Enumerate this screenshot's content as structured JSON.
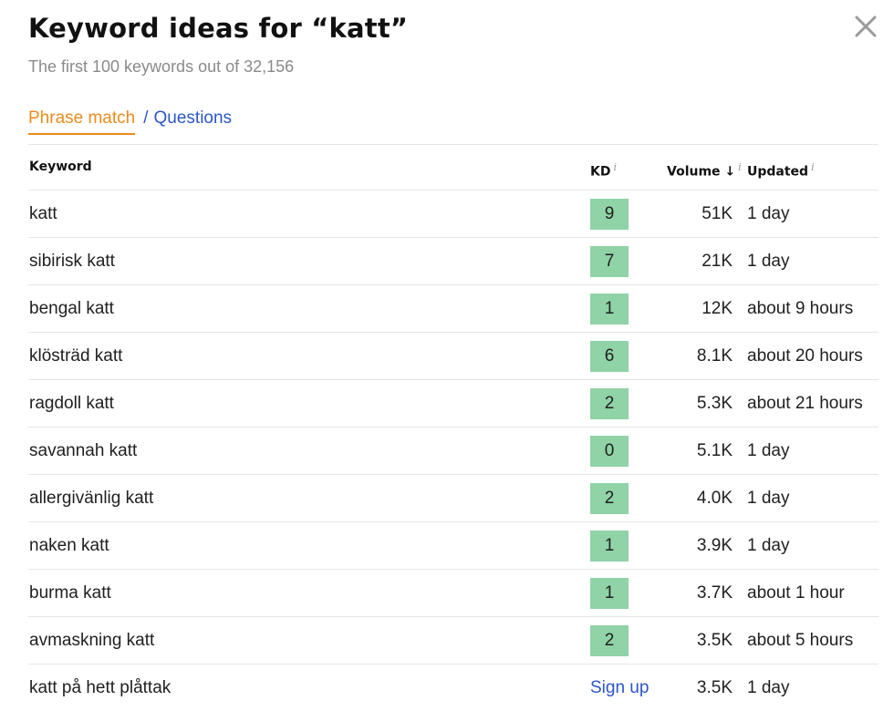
{
  "header": {
    "title": "Keyword ideas for “katt”",
    "subtitle": "The first 100 keywords out of 32,156"
  },
  "tabs": {
    "active": "Phrase match",
    "separator": "/",
    "other": "Questions"
  },
  "columns": {
    "keyword": "Keyword",
    "kd": "KD",
    "volume": "Volume",
    "volume_sort": "↓",
    "updated": "Updated",
    "info": "i"
  },
  "rows": [
    {
      "keyword": "katt",
      "kd": "9",
      "volume": "51K",
      "updated": "1 day"
    },
    {
      "keyword": "sibirisk katt",
      "kd": "7",
      "volume": "21K",
      "updated": "1 day"
    },
    {
      "keyword": "bengal katt",
      "kd": "1",
      "volume": "12K",
      "updated": "about 9 hours"
    },
    {
      "keyword": "klösträd katt",
      "kd": "6",
      "volume": "8.1K",
      "updated": "about 20 hours"
    },
    {
      "keyword": "ragdoll katt",
      "kd": "2",
      "volume": "5.3K",
      "updated": "about 21 hours"
    },
    {
      "keyword": "savannah katt",
      "kd": "0",
      "volume": "5.1K",
      "updated": "1 day"
    },
    {
      "keyword": "allergivänlig katt",
      "kd": "2",
      "volume": "4.0K",
      "updated": "1 day"
    },
    {
      "keyword": "naken katt",
      "kd": "1",
      "volume": "3.9K",
      "updated": "1 day"
    },
    {
      "keyword": "burma katt",
      "kd": "1",
      "volume": "3.7K",
      "updated": "about 1 hour"
    },
    {
      "keyword": "avmaskning katt",
      "kd": "2",
      "volume": "3.5K",
      "updated": "about 5 hours"
    }
  ],
  "locked_row": {
    "keyword": "katt på hett plåttak",
    "action": "Sign up",
    "volume": "3.5K",
    "updated": "1 day"
  },
  "colors": {
    "accent": "#ee8a1d",
    "link": "#2a56c6",
    "kd_badge": "#8fd3a7",
    "subtitle": "#8a8a8a"
  },
  "icons": {
    "close": "close-icon",
    "sort": "arrow-down-icon",
    "info": "info-icon"
  }
}
